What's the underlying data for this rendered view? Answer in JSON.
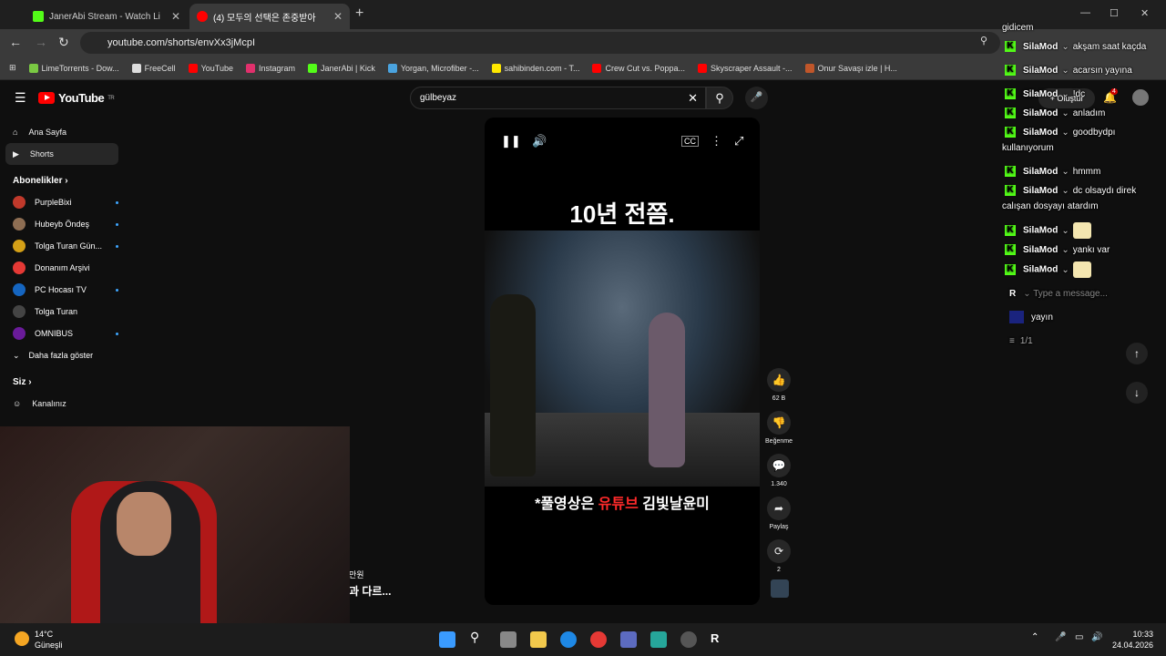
{
  "tabs": [
    {
      "title": "JanerAbi Stream - Watch Li",
      "color": "#53fc18",
      "active": false
    },
    {
      "title": "(4) 모두의 선택은 존중받아",
      "color": "#ff0000",
      "active": true
    }
  ],
  "address": {
    "url": "youtube.com/shorts/envXx3jMcpI"
  },
  "bookmarks": [
    {
      "label": "LimeTorrents - Dow...",
      "color": "#7ac943"
    },
    {
      "label": "FreeCell",
      "color": "#dddddd"
    },
    {
      "label": "YouTube",
      "color": "#ff0000"
    },
    {
      "label": "Instagram",
      "color": "#e1306c"
    },
    {
      "label": "JanerAbi | Kick",
      "color": "#53fc18"
    },
    {
      "label": "Yorgan, Microfiber -...",
      "color": "#4aa3df"
    },
    {
      "label": "sahibinden.com - T...",
      "color": "#ffe800"
    },
    {
      "label": "Crew Cut vs. Poppa...",
      "color": "#ff0000"
    },
    {
      "label": "Skyscraper Assault -...",
      "color": "#ff0000"
    },
    {
      "label": "Onur Savaşı izle | H...",
      "color": "#c0562a"
    }
  ],
  "youtube": {
    "logo": "YouTube",
    "region": "TR",
    "search_value": "gülbeyaz"
  },
  "sidebar": {
    "home": "Ana Sayfa",
    "shorts": "Shorts",
    "subs_header": "Abonelikler",
    "subs": [
      {
        "name": "PurpleBixi",
        "color": "#c0392b"
      },
      {
        "name": "Hubeyb Öndeş",
        "color": "#8e6e53"
      },
      {
        "name": "Tolga Turan Gün...",
        "color": "#d4a017"
      },
      {
        "name": "Donanım Arşivi",
        "color": "#e53935"
      },
      {
        "name": "PC Hocası TV",
        "color": "#1565c0"
      },
      {
        "name": "Tolga Turan",
        "color": "#444444"
      },
      {
        "name": "OMNIBUS",
        "color": "#6a1b9a"
      }
    ],
    "more": "Daha fazla göster",
    "you_header": "Siz",
    "channel": "Kanalınız"
  },
  "video": {
    "caption_top": "10년 전쯤.",
    "caption_bottom_a": "*풀영상은 ",
    "caption_bottom_b": "유튜브",
    "caption_bottom_c": " 김빛날윤미"
  },
  "actions": {
    "likes": "62 B",
    "dislike": "Beğenme",
    "comments": "1.340",
    "share": "Paylaş",
    "remix": "2"
  },
  "chat": {
    "messages": [
      {
        "user": "SilaMod",
        "text": "gidicem"
      },
      {
        "user": "SilaMod",
        "text": "akşam saat kaçda"
      },
      {
        "user": "SilaMod",
        "text": "acarsın yayına"
      },
      {
        "user": "SilaMod",
        "text": "!dc"
      },
      {
        "user": "SilaMod",
        "text": "anladım"
      },
      {
        "user": "SilaMod",
        "text": "goodbydpı kullanıyorum"
      },
      {
        "user": "SilaMod",
        "text": "hmmm"
      },
      {
        "user": "SilaMod",
        "text": "dc olsaydı direk calışan dosyayı atardım"
      },
      {
        "user": "SilaMod",
        "text": ""
      },
      {
        "user": "SilaMod",
        "text": "yankı var"
      },
      {
        "user": "SilaMod",
        "text": ""
      }
    ],
    "input_placeholder": "Type a message...",
    "stream_label": "yayın",
    "count": "1/1",
    "create": "Oluştur",
    "notifications": "4"
  },
  "overlay": {
    "line1": "만원",
    "line2": "과 다르..."
  },
  "taskbar": {
    "temp": "14°C",
    "weather": "Güneşli",
    "time": "10:33",
    "date": "24.04.2026"
  }
}
